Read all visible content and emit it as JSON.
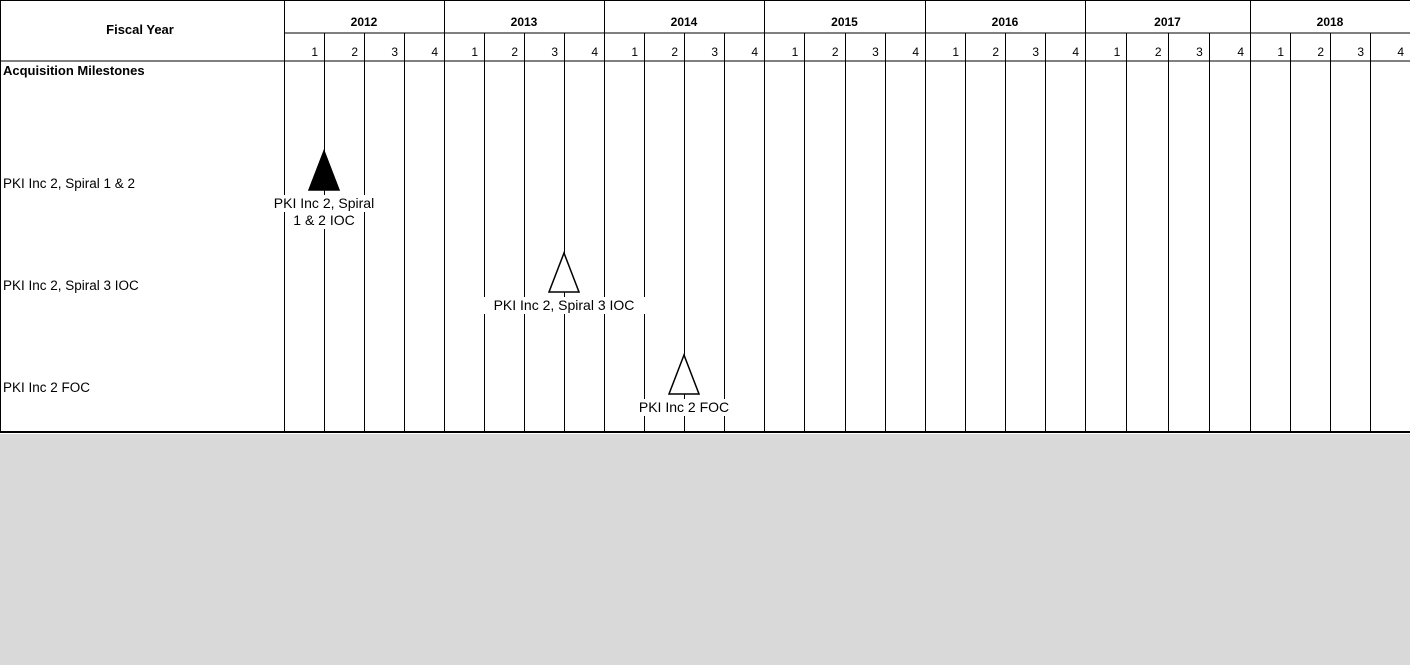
{
  "header": {
    "fiscal_year_label": "Fiscal Year",
    "section_label": "Acquisition Milestones"
  },
  "rows": [
    {
      "label": "PKI Inc 2, Spiral 1 & 2"
    },
    {
      "label": "PKI Inc 2, Spiral 3 IOC"
    },
    {
      "label": "PKI Inc 2 FOC"
    }
  ],
  "chart_data": {
    "type": "gantt-milestones",
    "xlabel": "Fiscal Year",
    "years": [
      "2012",
      "2013",
      "2014",
      "2015",
      "2016",
      "2017",
      "2018"
    ],
    "quarters": [
      "1",
      "2",
      "3",
      "4"
    ],
    "milestones": [
      {
        "row": 0,
        "year": "2012",
        "quarter": 1.5,
        "filled": true,
        "label_lines": [
          "PKI Inc 2, Spiral",
          "1 & 2 IOC"
        ]
      },
      {
        "row": 1,
        "year": "2013",
        "quarter": 3.5,
        "filled": false,
        "label_lines": [
          "PKI Inc 2, Spiral 3 IOC"
        ]
      },
      {
        "row": 2,
        "year": "2014",
        "quarter": 2.5,
        "filled": false,
        "label_lines": [
          "PKI Inc 2 FOC"
        ]
      }
    ]
  },
  "colors": {
    "grid": "#000000",
    "page_background": "#d9d9d9",
    "chart_background": "#ffffff"
  }
}
